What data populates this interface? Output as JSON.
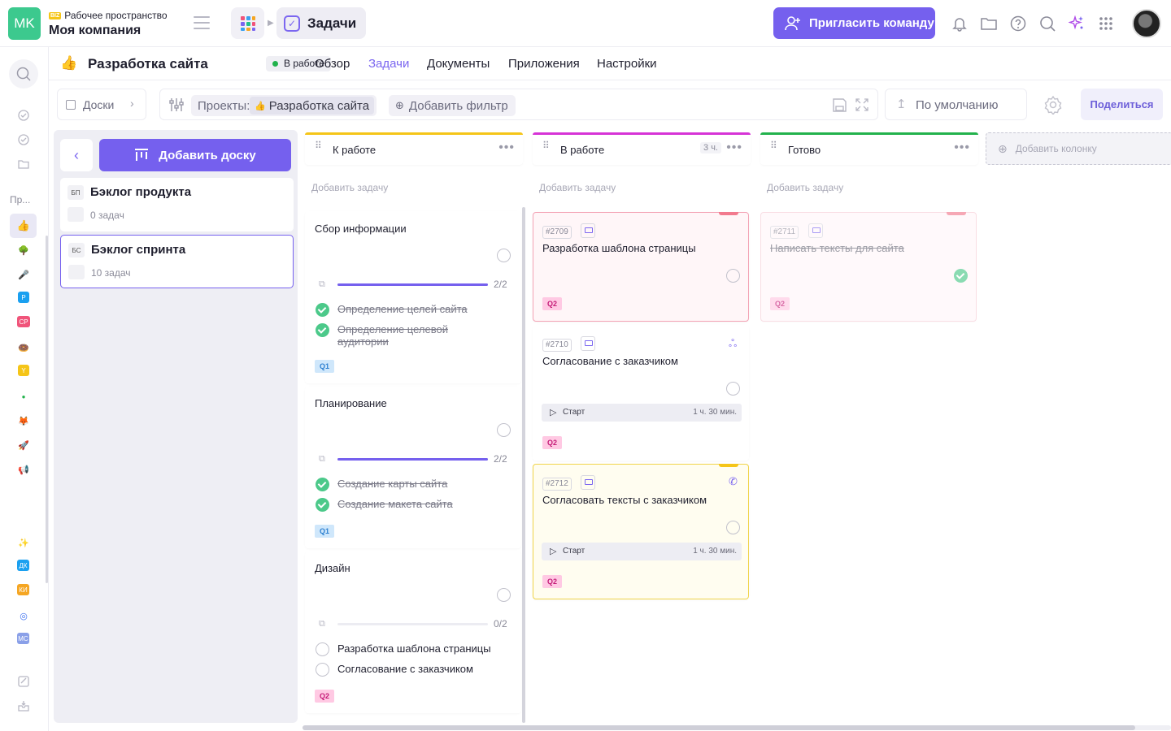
{
  "workspace": {
    "avatar": "MK",
    "biz": "BIZ",
    "label": "Рабочее пространство",
    "name": "Моя компания"
  },
  "header": {
    "section": "Задачи",
    "invite_label": "Пригласить команду"
  },
  "project": {
    "title": "Разработка сайта",
    "status": "В работе",
    "tabs": [
      "Обзор",
      "Задачи",
      "Документы",
      "Приложения",
      "Настройки"
    ],
    "active_tab": "Задачи"
  },
  "toolbar": {
    "boards_label": "Доски",
    "projects_label": "Проекты:",
    "project_chip": "Разработка сайта",
    "add_filter": "Добавить фильтр",
    "sort_label": "По умолчанию",
    "share_label": "Поделиться"
  },
  "sidebar": {
    "section_label": "Пр..."
  },
  "boards_panel": {
    "add_board_label": "Добавить доску",
    "boards": [
      {
        "abbr": "БП",
        "title": "Бэклог продукта",
        "count": "0 задач"
      },
      {
        "abbr": "БС",
        "title": "Бэклог спринта",
        "count": "10 задач"
      }
    ]
  },
  "columns": [
    {
      "name": "К работе",
      "color": "#f5c518",
      "count": "",
      "add_task": "Добавить задачу"
    },
    {
      "name": "В работе",
      "color": "#d633d6",
      "count": "3 ч.",
      "add_task": "Добавить задачу"
    },
    {
      "name": "Готово",
      "color": "#22b24c",
      "count": "",
      "add_task": "Добавить задачу"
    }
  ],
  "add_column_label": "Добавить колонку",
  "todo_cards": [
    {
      "title": "Сбор информации",
      "progress": "2/2",
      "progress_fraction": 1.0,
      "subtasks": [
        {
          "text": "Определение целей сайта",
          "done": true
        },
        {
          "text": "Определение целевой аудитории",
          "done": true
        }
      ],
      "tag": "Q1"
    },
    {
      "title": "Планирование",
      "progress": "2/2",
      "progress_fraction": 1.0,
      "subtasks": [
        {
          "text": "Создание карты сайта",
          "done": true
        },
        {
          "text": "Создание макета сайта",
          "done": true
        }
      ],
      "tag": "Q1"
    },
    {
      "title": "Дизайн",
      "progress": "0/2",
      "progress_fraction": 0.0,
      "subtasks": [
        {
          "text": "Разработка шаблона страницы",
          "done": false
        },
        {
          "text": "Согласование с заказчиком",
          "done": false
        }
      ],
      "tag": "Q2"
    }
  ],
  "inprogress_cards": [
    {
      "id": "#2709",
      "title": "Разработка шаблона страницы",
      "tag": "Q2",
      "bg": "#fff6f8",
      "border": "#f3a2b4",
      "flag": "#f27a8e"
    },
    {
      "id": "#2710",
      "title": "Согласование с заказчиком",
      "tag": "Q2",
      "timer_label": "Старт",
      "timer": "1 ч. 30 мин."
    },
    {
      "id": "#2712",
      "title": "Согласовать тексты с заказчиком",
      "tag": "Q2",
      "timer_label": "Старт",
      "timer": "1 ч. 30 мин.",
      "bg": "#fffdf0",
      "border": "#f0d44a",
      "flag": "#f5c518"
    }
  ],
  "done_cards": [
    {
      "id": "#2711",
      "title": "Написать тексты для сайта",
      "tag": "Q2",
      "done": true
    }
  ]
}
